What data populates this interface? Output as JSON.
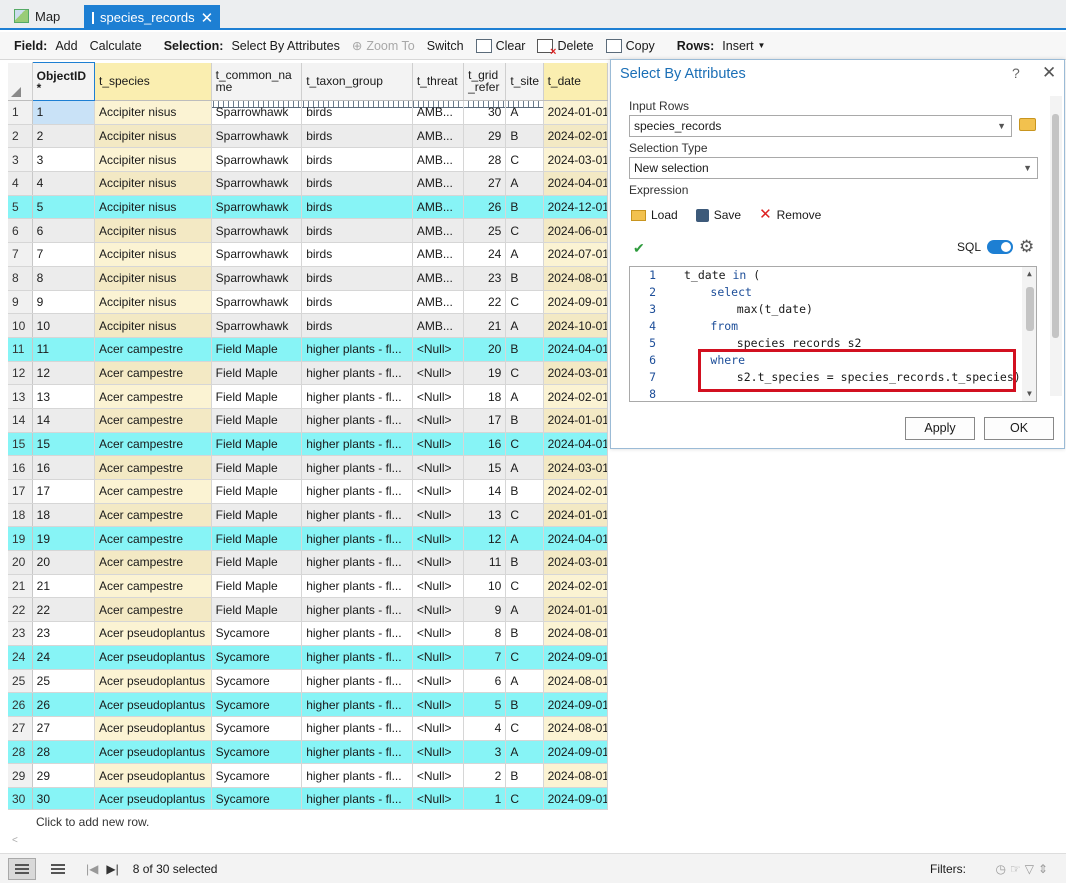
{
  "tabs": [
    {
      "label": "Map",
      "active": false
    },
    {
      "label": "species_records",
      "active": true
    }
  ],
  "toolbar": {
    "field_label": "Field:",
    "add": "Add",
    "calculate": "Calculate",
    "selection_label": "Selection:",
    "select_by_attributes": "Select By Attributes",
    "zoom_to": "Zoom To",
    "switch": "Switch",
    "clear": "Clear",
    "delete": "Delete",
    "copy": "Copy",
    "rows_label": "Rows:",
    "insert": "Insert"
  },
  "table": {
    "headers": [
      "ObjectID *",
      "t_species",
      "t_common_na me",
      "t_taxon_group",
      "t_threat",
      "t_grid _refer",
      "t_site",
      "t_date"
    ],
    "rows": [
      {
        "n": "1",
        "oid": "1",
        "sp": "Accipiter nisus",
        "cn": "Sparrowhawk",
        "tg": "birds",
        "th": "AMB...",
        "gr": "30",
        "site": "A",
        "date": "2024-01-01",
        "sel": false
      },
      {
        "n": "2",
        "oid": "2",
        "sp": "Accipiter nisus",
        "cn": "Sparrowhawk",
        "tg": "birds",
        "th": "AMB...",
        "gr": "29",
        "site": "B",
        "date": "2024-02-01",
        "sel": false
      },
      {
        "n": "3",
        "oid": "3",
        "sp": "Accipiter nisus",
        "cn": "Sparrowhawk",
        "tg": "birds",
        "th": "AMB...",
        "gr": "28",
        "site": "C",
        "date": "2024-03-01",
        "sel": false
      },
      {
        "n": "4",
        "oid": "4",
        "sp": "Accipiter nisus",
        "cn": "Sparrowhawk",
        "tg": "birds",
        "th": "AMB...",
        "gr": "27",
        "site": "A",
        "date": "2024-04-01",
        "sel": false
      },
      {
        "n": "5",
        "oid": "5",
        "sp": "Accipiter nisus",
        "cn": "Sparrowhawk",
        "tg": "birds",
        "th": "AMB...",
        "gr": "26",
        "site": "B",
        "date": "2024-12-01",
        "sel": true
      },
      {
        "n": "6",
        "oid": "6",
        "sp": "Accipiter nisus",
        "cn": "Sparrowhawk",
        "tg": "birds",
        "th": "AMB...",
        "gr": "25",
        "site": "C",
        "date": "2024-06-01",
        "sel": false
      },
      {
        "n": "7",
        "oid": "7",
        "sp": "Accipiter nisus",
        "cn": "Sparrowhawk",
        "tg": "birds",
        "th": "AMB...",
        "gr": "24",
        "site": "A",
        "date": "2024-07-01",
        "sel": false
      },
      {
        "n": "8",
        "oid": "8",
        "sp": "Accipiter nisus",
        "cn": "Sparrowhawk",
        "tg": "birds",
        "th": "AMB...",
        "gr": "23",
        "site": "B",
        "date": "2024-08-01",
        "sel": false
      },
      {
        "n": "9",
        "oid": "9",
        "sp": "Accipiter nisus",
        "cn": "Sparrowhawk",
        "tg": "birds",
        "th": "AMB...",
        "gr": "22",
        "site": "C",
        "date": "2024-09-01",
        "sel": false
      },
      {
        "n": "10",
        "oid": "10",
        "sp": "Accipiter nisus",
        "cn": "Sparrowhawk",
        "tg": "birds",
        "th": "AMB...",
        "gr": "21",
        "site": "A",
        "date": "2024-10-01",
        "sel": false
      },
      {
        "n": "11",
        "oid": "11",
        "sp": "Acer campestre",
        "cn": "Field Maple",
        "tg": "higher plants - fl...",
        "th": "<Null>",
        "gr": "20",
        "site": "B",
        "date": "2024-04-01",
        "sel": true
      },
      {
        "n": "12",
        "oid": "12",
        "sp": "Acer campestre",
        "cn": "Field Maple",
        "tg": "higher plants - fl...",
        "th": "<Null>",
        "gr": "19",
        "site": "C",
        "date": "2024-03-01",
        "sel": false
      },
      {
        "n": "13",
        "oid": "13",
        "sp": "Acer campestre",
        "cn": "Field Maple",
        "tg": "higher plants - fl...",
        "th": "<Null>",
        "gr": "18",
        "site": "A",
        "date": "2024-02-01",
        "sel": false
      },
      {
        "n": "14",
        "oid": "14",
        "sp": "Acer campestre",
        "cn": "Field Maple",
        "tg": "higher plants - fl...",
        "th": "<Null>",
        "gr": "17",
        "site": "B",
        "date": "2024-01-01",
        "sel": false
      },
      {
        "n": "15",
        "oid": "15",
        "sp": "Acer campestre",
        "cn": "Field Maple",
        "tg": "higher plants - fl...",
        "th": "<Null>",
        "gr": "16",
        "site": "C",
        "date": "2024-04-01",
        "sel": true
      },
      {
        "n": "16",
        "oid": "16",
        "sp": "Acer campestre",
        "cn": "Field Maple",
        "tg": "higher plants - fl...",
        "th": "<Null>",
        "gr": "15",
        "site": "A",
        "date": "2024-03-01",
        "sel": false
      },
      {
        "n": "17",
        "oid": "17",
        "sp": "Acer campestre",
        "cn": "Field Maple",
        "tg": "higher plants - fl...",
        "th": "<Null>",
        "gr": "14",
        "site": "B",
        "date": "2024-02-01",
        "sel": false
      },
      {
        "n": "18",
        "oid": "18",
        "sp": "Acer campestre",
        "cn": "Field Maple",
        "tg": "higher plants - fl...",
        "th": "<Null>",
        "gr": "13",
        "site": "C",
        "date": "2024-01-01",
        "sel": false
      },
      {
        "n": "19",
        "oid": "19",
        "sp": "Acer campestre",
        "cn": "Field Maple",
        "tg": "higher plants - fl...",
        "th": "<Null>",
        "gr": "12",
        "site": "A",
        "date": "2024-04-01",
        "sel": true
      },
      {
        "n": "20",
        "oid": "20",
        "sp": "Acer campestre",
        "cn": "Field Maple",
        "tg": "higher plants - fl...",
        "th": "<Null>",
        "gr": "11",
        "site": "B",
        "date": "2024-03-01",
        "sel": false
      },
      {
        "n": "21",
        "oid": "21",
        "sp": "Acer campestre",
        "cn": "Field Maple",
        "tg": "higher plants - fl...",
        "th": "<Null>",
        "gr": "10",
        "site": "C",
        "date": "2024-02-01",
        "sel": false
      },
      {
        "n": "22",
        "oid": "22",
        "sp": "Acer campestre",
        "cn": "Field Maple",
        "tg": "higher plants - fl...",
        "th": "<Null>",
        "gr": "9",
        "site": "A",
        "date": "2024-01-01",
        "sel": false
      },
      {
        "n": "23",
        "oid": "23",
        "sp": "Acer pseudoplantus",
        "cn": "Sycamore",
        "tg": "higher plants - fl...",
        "th": "<Null>",
        "gr": "8",
        "site": "B",
        "date": "2024-08-01",
        "sel": false
      },
      {
        "n": "24",
        "oid": "24",
        "sp": "Acer pseudoplantus",
        "cn": "Sycamore",
        "tg": "higher plants - fl...",
        "th": "<Null>",
        "gr": "7",
        "site": "C",
        "date": "2024-09-01",
        "sel": true
      },
      {
        "n": "25",
        "oid": "25",
        "sp": "Acer pseudoplantus",
        "cn": "Sycamore",
        "tg": "higher plants - fl...",
        "th": "<Null>",
        "gr": "6",
        "site": "A",
        "date": "2024-08-01",
        "sel": false
      },
      {
        "n": "26",
        "oid": "26",
        "sp": "Acer pseudoplantus",
        "cn": "Sycamore",
        "tg": "higher plants - fl...",
        "th": "<Null>",
        "gr": "5",
        "site": "B",
        "date": "2024-09-01",
        "sel": true
      },
      {
        "n": "27",
        "oid": "27",
        "sp": "Acer pseudoplantus",
        "cn": "Sycamore",
        "tg": "higher plants - fl...",
        "th": "<Null>",
        "gr": "4",
        "site": "C",
        "date": "2024-08-01",
        "sel": false
      },
      {
        "n": "28",
        "oid": "28",
        "sp": "Acer pseudoplantus",
        "cn": "Sycamore",
        "tg": "higher plants - fl...",
        "th": "<Null>",
        "gr": "3",
        "site": "A",
        "date": "2024-09-01",
        "sel": true
      },
      {
        "n": "29",
        "oid": "29",
        "sp": "Acer pseudoplantus",
        "cn": "Sycamore",
        "tg": "higher plants - fl...",
        "th": "<Null>",
        "gr": "2",
        "site": "B",
        "date": "2024-08-01",
        "sel": false
      },
      {
        "n": "30",
        "oid": "30",
        "sp": "Acer pseudoplantus",
        "cn": "Sycamore",
        "tg": "higher plants - fl...",
        "th": "<Null>",
        "gr": "1",
        "site": "C",
        "date": "2024-09-01",
        "sel": true
      }
    ],
    "add_row_text": "Click to add new row."
  },
  "status": {
    "selected_text": "8 of 30 selected",
    "filters_label": "Filters:"
  },
  "dialog": {
    "title": "Select By Attributes",
    "help": "?",
    "close": "✕",
    "input_rows_label": "Input Rows",
    "input_rows_value": "species_records",
    "selection_type_label": "Selection Type",
    "selection_type_value": "New selection",
    "expression_label": "Expression",
    "load": "Load",
    "save": "Save",
    "remove": "Remove",
    "sql_label": "SQL",
    "code_lines": [
      {
        "n": "1",
        "indent": 0,
        "kw": "",
        "text": "t_date in (",
        "kwpart": "in"
      },
      {
        "n": "2",
        "indent": 4,
        "kw": "select",
        "text": ""
      },
      {
        "n": "3",
        "indent": 8,
        "kw": "",
        "text": "max(t_date)"
      },
      {
        "n": "4",
        "indent": 4,
        "kw": "from",
        "text": ""
      },
      {
        "n": "5",
        "indent": 8,
        "kw": "",
        "text": "species_records s2"
      },
      {
        "n": "6",
        "indent": 4,
        "kw": "where",
        "text": ""
      },
      {
        "n": "7",
        "indent": 8,
        "kw": "",
        "text": "s2.t_species = species_records.t_species)"
      },
      {
        "n": "8",
        "indent": 0,
        "kw": "",
        "text": ""
      }
    ],
    "apply": "Apply",
    "ok": "OK"
  },
  "colors": {
    "accent": "#1d7fd3",
    "selected_row": "#87f4f6",
    "highlight_box": "#d21020",
    "yellow_column": "#fbf3d3"
  }
}
